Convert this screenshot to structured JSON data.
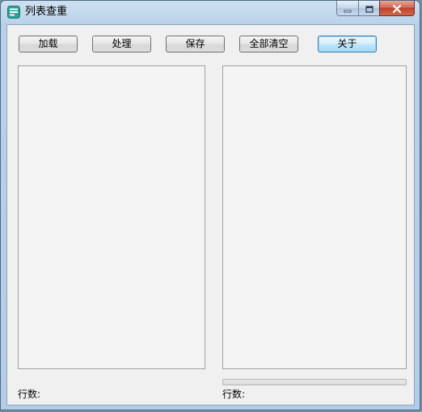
{
  "window": {
    "title": "列表查重"
  },
  "toolbar": {
    "load_label": "加载",
    "process_label": "处理",
    "save_label": "保存",
    "clear_all_label": "全部清空",
    "about_label": "关于"
  },
  "status": {
    "left_rows_label": "行数:",
    "right_rows_label": "行数:"
  },
  "progress": {
    "value": 0
  },
  "icons": {
    "app": "list-app-icon",
    "minimize": "minimize-icon",
    "maximize": "maximize-icon",
    "close": "close-icon"
  },
  "colors": {
    "focus_border": "#3c7fb1",
    "close_button": "#c23f28"
  }
}
